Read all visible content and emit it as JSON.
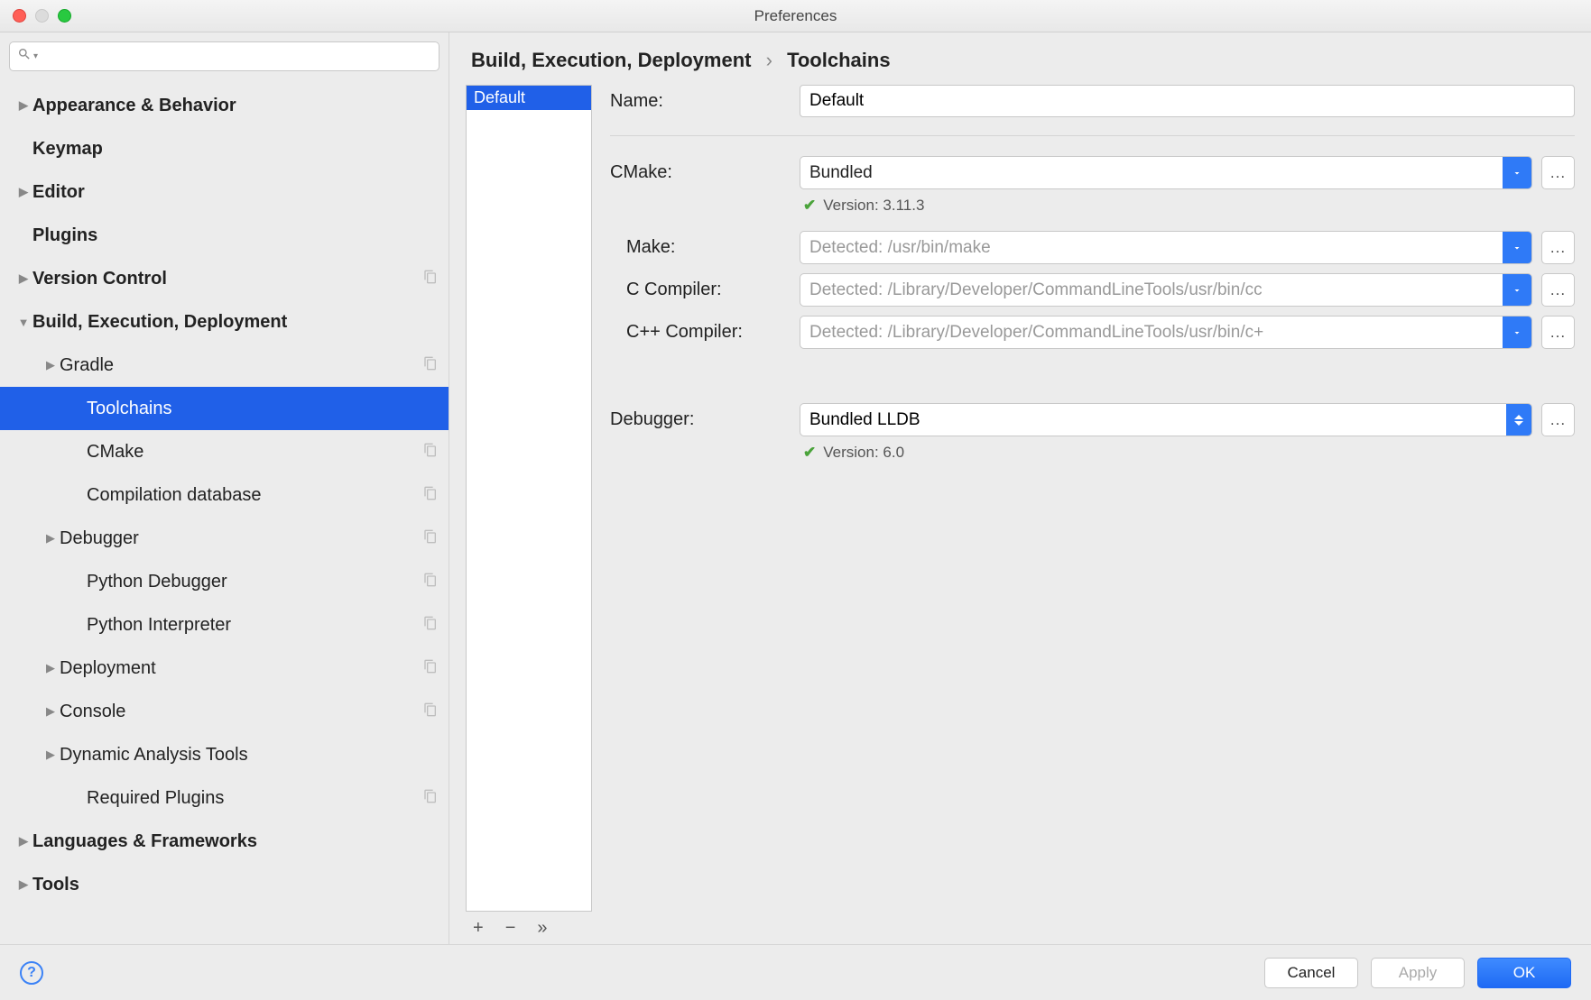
{
  "window": {
    "title": "Preferences"
  },
  "search": {
    "placeholder": ""
  },
  "tree": [
    {
      "label": "Appearance & Behavior",
      "depth": 0,
      "bold": true,
      "arrow": "right",
      "copy": false
    },
    {
      "label": "Keymap",
      "depth": 0,
      "bold": true,
      "arrow": "",
      "copy": false
    },
    {
      "label": "Editor",
      "depth": 0,
      "bold": true,
      "arrow": "right",
      "copy": false
    },
    {
      "label": "Plugins",
      "depth": 0,
      "bold": true,
      "arrow": "",
      "copy": false
    },
    {
      "label": "Version Control",
      "depth": 0,
      "bold": true,
      "arrow": "right",
      "copy": true
    },
    {
      "label": "Build, Execution, Deployment",
      "depth": 0,
      "bold": true,
      "arrow": "down",
      "copy": false
    },
    {
      "label": "Gradle",
      "depth": 1,
      "bold": false,
      "arrow": "right",
      "copy": true
    },
    {
      "label": "Toolchains",
      "depth": 2,
      "bold": false,
      "arrow": "",
      "copy": false,
      "selected": true
    },
    {
      "label": "CMake",
      "depth": 2,
      "bold": false,
      "arrow": "",
      "copy": true
    },
    {
      "label": "Compilation database",
      "depth": 2,
      "bold": false,
      "arrow": "",
      "copy": true
    },
    {
      "label": "Debugger",
      "depth": 1,
      "bold": false,
      "arrow": "right",
      "copy": true
    },
    {
      "label": "Python Debugger",
      "depth": 2,
      "bold": false,
      "arrow": "",
      "copy": true
    },
    {
      "label": "Python Interpreter",
      "depth": 2,
      "bold": false,
      "arrow": "",
      "copy": true
    },
    {
      "label": "Deployment",
      "depth": 1,
      "bold": false,
      "arrow": "right",
      "copy": true
    },
    {
      "label": "Console",
      "depth": 1,
      "bold": false,
      "arrow": "right",
      "copy": true
    },
    {
      "label": "Dynamic Analysis Tools",
      "depth": 1,
      "bold": false,
      "arrow": "right",
      "copy": false
    },
    {
      "label": "Required Plugins",
      "depth": 2,
      "bold": false,
      "arrow": "",
      "copy": true
    },
    {
      "label": "Languages & Frameworks",
      "depth": 0,
      "bold": true,
      "arrow": "right",
      "copy": false
    },
    {
      "label": "Tools",
      "depth": 0,
      "bold": true,
      "arrow": "right",
      "copy": false
    }
  ],
  "breadcrumb": {
    "root": "Build, Execution, Deployment",
    "leaf": "Toolchains"
  },
  "toolchains": {
    "selected": "Default"
  },
  "list_toolbar": {
    "add": "+",
    "remove": "−",
    "more": "»"
  },
  "form": {
    "name_label": "Name:",
    "name_value": "Default",
    "cmake_label": "CMake:",
    "cmake_value": "Bundled",
    "cmake_version": "Version: 3.11.3",
    "make_label": "Make:",
    "make_placeholder": "Detected: /usr/bin/make",
    "ccompiler_label": "C Compiler:",
    "ccompiler_placeholder": "Detected: /Library/Developer/CommandLineTools/usr/bin/cc",
    "cppcompiler_label": "C++ Compiler:",
    "cppcompiler_placeholder": "Detected: /Library/Developer/CommandLineTools/usr/bin/c+",
    "debugger_label": "Debugger:",
    "debugger_value": "Bundled LLDB",
    "debugger_version": "Version: 6.0",
    "browse": "..."
  },
  "footer": {
    "cancel": "Cancel",
    "apply": "Apply",
    "ok": "OK",
    "help": "?"
  }
}
